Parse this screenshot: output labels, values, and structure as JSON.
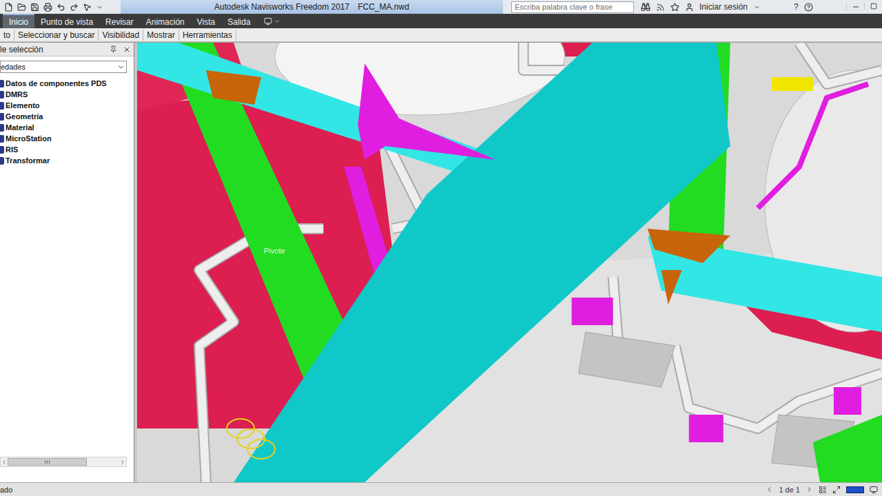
{
  "window": {
    "title": "Autodesk Navisworks Freedom 2017",
    "file": "FCC_MA.nwd"
  },
  "search": {
    "placeholder": "Escriba palabra clave o frase"
  },
  "signin": "Iniciar sesión",
  "help": "?",
  "tabs": [
    {
      "label": "Inicio",
      "selected": true
    },
    {
      "label": "Punto de vista",
      "selected": false
    },
    {
      "label": "Revisar",
      "selected": false
    },
    {
      "label": "Animación",
      "selected": false
    },
    {
      "label": "Vista",
      "selected": false
    },
    {
      "label": "Salida",
      "selected": false
    }
  ],
  "ribbon_panels": [
    "to",
    "Seleccionar y buscar",
    "Visibilidad",
    "Mostrar",
    "Herramientas"
  ],
  "sidebar": {
    "title": "le selección",
    "dropdown": "edades",
    "items": [
      "Datos de componentes PDS",
      "DMRS",
      "Elemento",
      "Geometría",
      "Material",
      "MicroStation",
      "RIS",
      "Transformar"
    ]
  },
  "viewport": {
    "pivot_label": "Pivote"
  },
  "status_bar": {
    "left": "ado",
    "page": "1 de 1"
  }
}
